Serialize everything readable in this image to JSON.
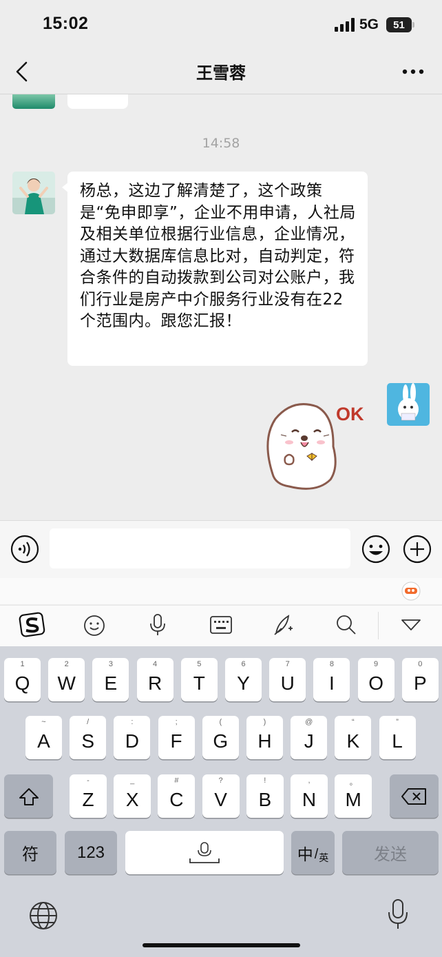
{
  "status_bar": {
    "time": "15:02",
    "network": "5G",
    "battery": "51"
  },
  "header": {
    "title": "王雪蓉"
  },
  "chat": {
    "timestamp": "14:58",
    "message": "杨总，这边了解清楚了，这个政策是“免申即享”，企业不用申请，人社局及相关单位根据行业信息，企业情况，通过大数据库信息比对，自动判定，符合条件的自动拨款到公司对公账户，我们行业是房产中介服务行业没有在22个范围内。跟您汇报！",
    "sticker_text": "OK"
  },
  "keyboard": {
    "row1": [
      {
        "l": "Q",
        "s": "1"
      },
      {
        "l": "W",
        "s": "2"
      },
      {
        "l": "E",
        "s": "3"
      },
      {
        "l": "R",
        "s": "4"
      },
      {
        "l": "T",
        "s": "5"
      },
      {
        "l": "Y",
        "s": "6"
      },
      {
        "l": "U",
        "s": "7"
      },
      {
        "l": "I",
        "s": "8"
      },
      {
        "l": "O",
        "s": "9"
      },
      {
        "l": "P",
        "s": "0"
      }
    ],
    "row2": [
      {
        "l": "A",
        "s": "~"
      },
      {
        "l": "S",
        "s": "/"
      },
      {
        "l": "D",
        "s": ":"
      },
      {
        "l": "F",
        "s": ";"
      },
      {
        "l": "G",
        "s": "("
      },
      {
        "l": "H",
        "s": ")"
      },
      {
        "l": "J",
        "s": "@"
      },
      {
        "l": "K",
        "s": "“"
      },
      {
        "l": "L",
        "s": "”"
      }
    ],
    "row3": [
      {
        "l": "Z",
        "s": "-"
      },
      {
        "l": "X",
        "s": "_"
      },
      {
        "l": "C",
        "s": "#"
      },
      {
        "l": "V",
        "s": "?"
      },
      {
        "l": "B",
        "s": "!"
      },
      {
        "l": "N",
        "s": ","
      },
      {
        "l": "M",
        "s": "。"
      }
    ],
    "symbols_label": "符",
    "numbers_label": "123",
    "lang_main": "中",
    "lang_alt": "英",
    "send_label": "发送"
  }
}
